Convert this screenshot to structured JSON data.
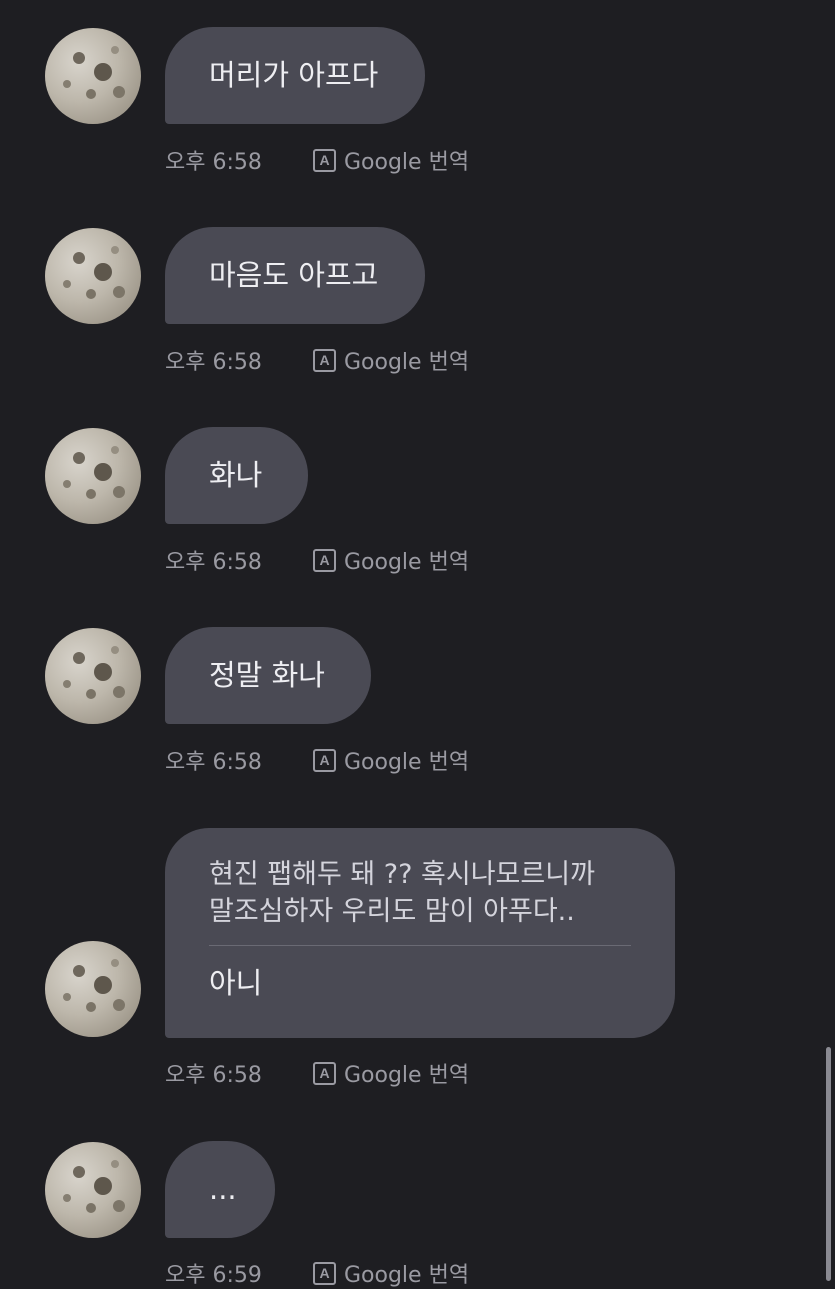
{
  "messages": [
    {
      "text": "머리가 아프다",
      "time": "오후 6:58",
      "translate": "Google 번역"
    },
    {
      "text": "마음도 아프고",
      "time": "오후 6:58",
      "translate": "Google 번역"
    },
    {
      "text": "화나",
      "time": "오후 6:58",
      "translate": "Google 번역"
    },
    {
      "text": "정말 화나",
      "time": "오후 6:58",
      "translate": "Google 번역"
    },
    {
      "quote_line1": "현진 팹해두 돼 ?? 혹시나모르니까",
      "quote_line2": "말조심하자 우리도 맘이 아푸다..",
      "text": "아니",
      "time": "오후 6:58",
      "translate": "Google 번역"
    },
    {
      "text": "...",
      "time": "오후 6:59",
      "translate": "Google 번역"
    }
  ],
  "icons": {
    "translate": "translate-icon",
    "avatar": "profile-avatar"
  },
  "colors": {
    "background": "#1e1e22",
    "bubble": "#4a4a54",
    "meta_text": "#9a9aa2",
    "message_text": "#eeeef2"
  },
  "translate_icon_glyph": "A"
}
